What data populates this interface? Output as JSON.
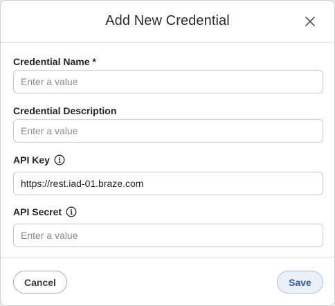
{
  "dialog": {
    "title": "Add New Credential",
    "close_icon": "close-icon"
  },
  "fields": {
    "name": {
      "label": "Credential Name *",
      "placeholder": "Enter a value",
      "value": ""
    },
    "description": {
      "label": "Credential Description",
      "placeholder": "Enter a value",
      "value": ""
    },
    "api_key": {
      "label": "API Key",
      "icon": "info-icon",
      "placeholder": "Enter a value",
      "value": "https://rest.iad-01.braze.com"
    },
    "api_secret": {
      "label": "API Secret",
      "icon": "info-icon",
      "placeholder": "Enter a value",
      "value": ""
    }
  },
  "footer": {
    "cancel_label": "Cancel",
    "save_label": "Save"
  },
  "colors": {
    "save_accent": "#2e5aa8",
    "save_bg": "#eaf1fb"
  }
}
